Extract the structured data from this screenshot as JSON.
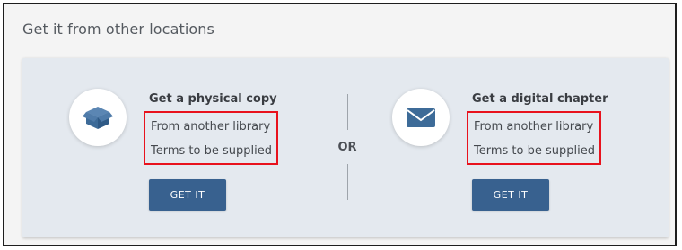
{
  "section": {
    "title": "Get it from other locations"
  },
  "options": [
    {
      "title": "Get a physical copy",
      "details": [
        "From another library",
        "Terms to be supplied"
      ],
      "button_label": "GET IT",
      "icon": "package-icon"
    },
    {
      "title": "Get a digital chapter",
      "details": [
        "From another library",
        "Terms to be supplied"
      ],
      "button_label": "GET IT",
      "icon": "envelope-icon"
    }
  ],
  "separator_label": "OR",
  "colors": {
    "button": "#38618f",
    "panel": "#e4e9ef",
    "icon": "#3d6b98",
    "highlight_border": "#e8121d"
  }
}
